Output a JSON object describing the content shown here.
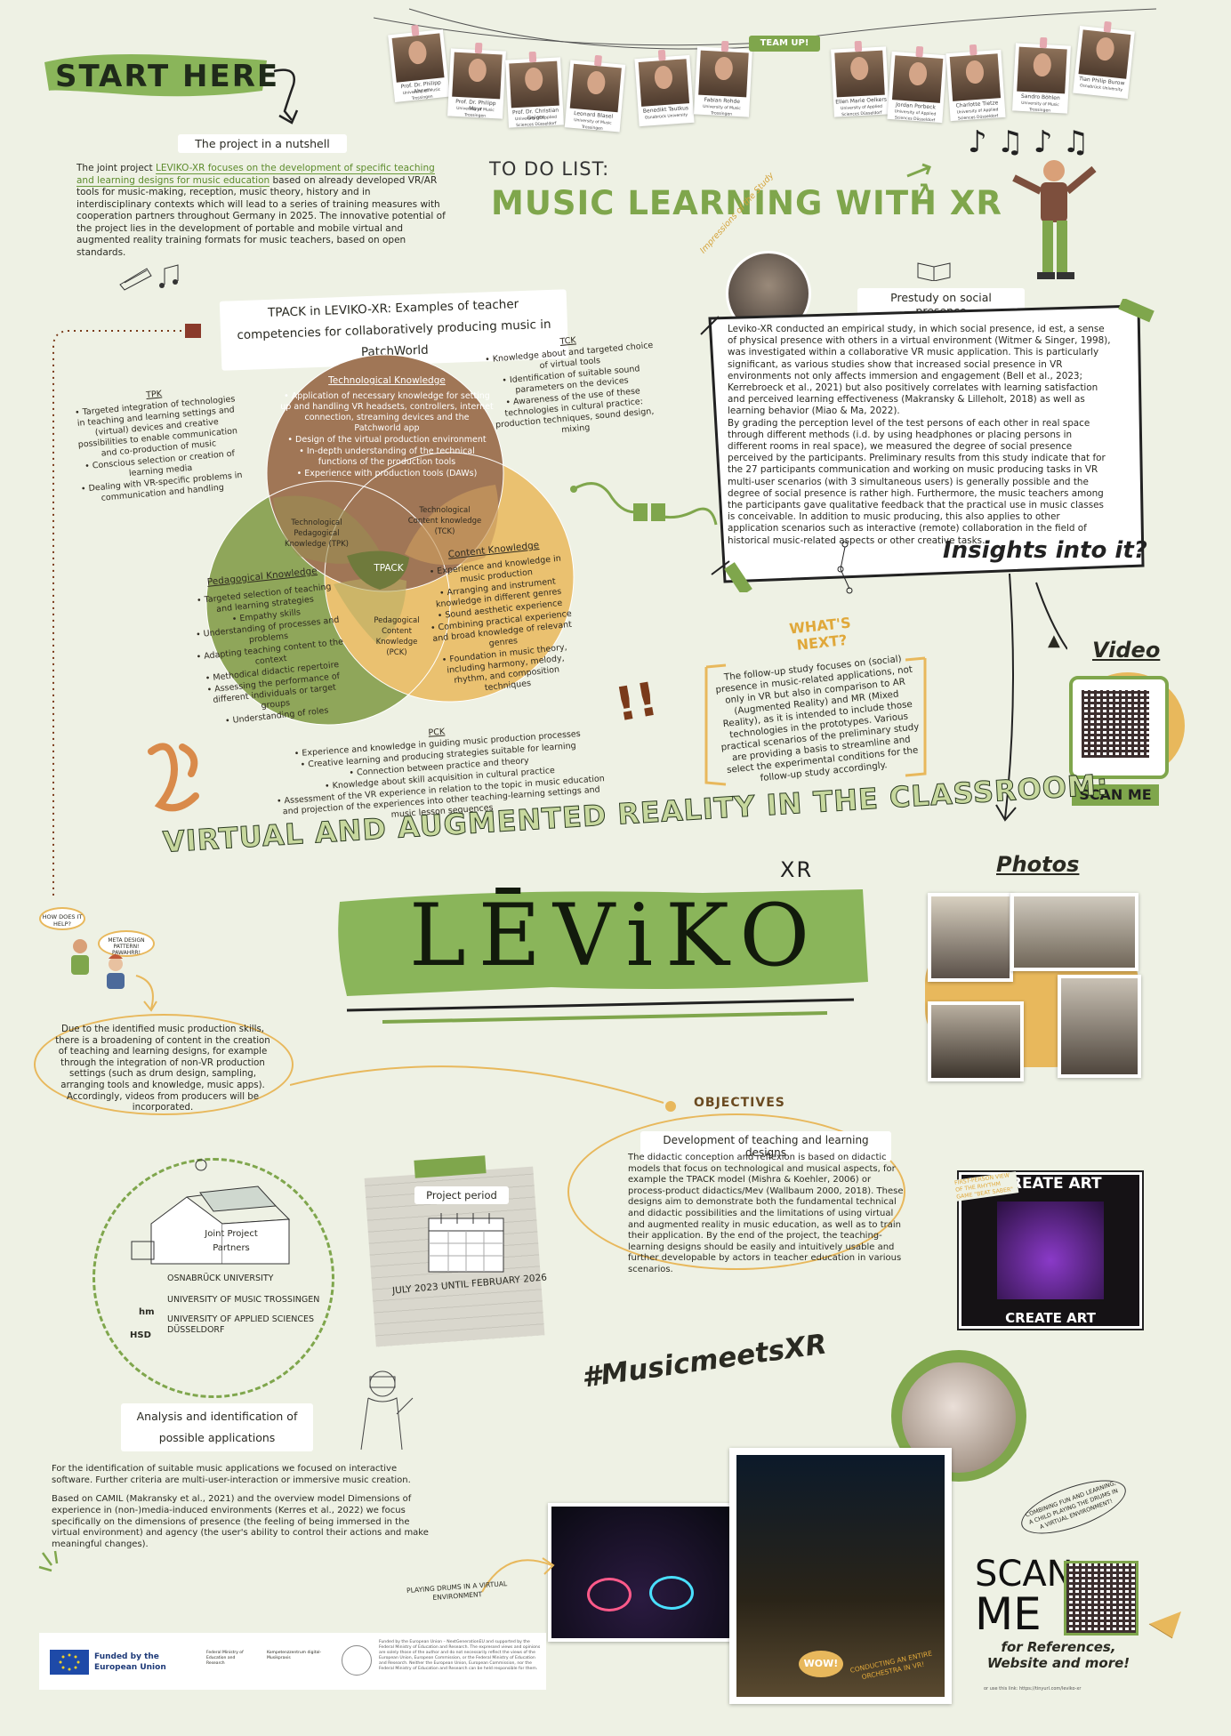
{
  "start_here": "START HERE",
  "team": {
    "badge": "TEAM UP!",
    "members": [
      {
        "name": "Prof. Dr. Philipp Ahner",
        "role": "University of Music Trossingen"
      },
      {
        "name": "Prof. Dr. Philipp Mayr",
        "role": "University of Music Trossingen"
      },
      {
        "name": "Prof. Dr. Christian Geiger",
        "role": "University of Applied Sciences Düsseldorf"
      },
      {
        "name": "Leonard Blasel",
        "role": "University of Music Trossingen"
      },
      {
        "name": "Benedikt Tautkus",
        "role": "Osnabrück University"
      },
      {
        "name": "Fabian Rohde",
        "role": "University of Music Trossingen"
      },
      {
        "name": "Ellen Marie Oelkers",
        "role": "University of Applied Sciences Düsseldorf"
      },
      {
        "name": "Jordan Porbeck",
        "role": "University of Applied Sciences Düsseldorf"
      },
      {
        "name": "Charlotte Tietze",
        "role": "University of Applied Sciences Düsseldorf"
      },
      {
        "name": "Sandro Böhlen",
        "role": "University of Music Trossingen"
      },
      {
        "name": "Tian Philip Burow",
        "role": "Osnabrück University"
      }
    ]
  },
  "nutshell": {
    "heading": "The project in a nutshell",
    "text_before": "The joint project ",
    "text_link": "LEVIKO-XR focuses on the development of specific teaching and learning designs for music education",
    "text_after": " based on already developed VR/AR tools for music-making, reception, music theory, history and in interdisciplinary contexts which will lead to a series of training measures with cooperation partners throughout Germany in 2025. The innovative potential of the project lies in the development of portable and mobile virtual and augmented reality training formats for music teachers, based on open standards."
  },
  "todo": {
    "line1": "TO DO LIST:",
    "line2": "MUSIC LEARNING WITH XR"
  },
  "tpack": {
    "heading": "TPACK in LEVIKO-XR: Examples of teacher competencies for collaboratively producing music in PatchWorld",
    "tpk_label": "TPK",
    "tpk_items": [
      "Targeted integration of technologies in teaching and learning settings and (virtual) devices and creative possibilities to enable communication and co-production of music",
      "Conscious selection or creation of learning media",
      "Dealing with VR-specific problems in communication and handling"
    ],
    "tck_label": "TCK",
    "tck_items": [
      "Knowledge about and targeted choice of virtual tools",
      "Identification of suitable sound parameters on the devices",
      "Awareness of the use of these technologies in cultural practice: production techniques, sound design, mixing"
    ],
    "tk_title": "Technological Knowledge",
    "tk_items": [
      "Application of necessary knowledge for setting up and handling VR headsets, controllers, internet connection, streaming devices and the Patchworld app",
      "Design of the virtual production environment",
      "In-depth understanding of the technical functions of the production tools",
      "Experience with production tools (DAWs)"
    ],
    "pk_title": "Pedagogical Knowledge",
    "pk_items": [
      "Targeted selection of teaching and learning strategies",
      "Empathy skills",
      "Understanding of processes and problems",
      "Adapting teaching content to the context",
      "Methodical didactic repertoire",
      "Assessing the performance of different individuals or target groups",
      "Understanding of roles"
    ],
    "ck_title": "Content Knowledge",
    "ck_items": [
      "Experience and knowledge in music production",
      "Arranging and instrument knowledge in different genres",
      "Sound aesthetic experience",
      "Combining practical experience and broad knowledge of relevant genres",
      "Foundation in music theory, including harmony, melody, rhythm, and composition techniques"
    ],
    "tpk_center": "Technological Pedagogical Knowledge (TPK)",
    "tck_center": "Technological Content knowledge (TCK)",
    "pck_center": "Pedagogical Content Knowledge (PCK)",
    "tpack_center": "TPACK",
    "pck_label": "PCK",
    "pck_items": [
      "Experience and knowledge in guiding music production processes",
      "Creative learning and producing strategies suitable for learning",
      "Connection between practice and theory",
      "Knowledge about skill acquisition in cultural practice",
      "Assessment of the VR experience in relation to the topic in music education and projection of the experiences into other teaching-learning settings and music lesson sequences"
    ]
  },
  "prestudy": {
    "impressions": "Impressions of the Study",
    "heading": "Prestudy on social presence",
    "text": "Leviko-XR conducted an empirical study, in which social presence, id est, a sense of physical presence with others in a virtual environment (Witmer & Singer, 1998), was investigated within a collaborative VR music application. This is particularly significant, as various studies show that increased social presence in VR environments not only affects immersion and engagement (Bell et al., 2023; Kerrebroeck et al., 2021) but also positively correlates with learning satisfaction and perceived learning effectiveness (Makransky & Lilleholt, 2018) as well as learning behavior (Miao & Ma, 2022).\nBy grading the perception level of the test persons of each other in real space through different methods (i.d. by using headphones or placing persons in different rooms in real space), we measured the degree of social presence perceived by the participants. Preliminary results from this study indicate that for the 27 participants communication and working on music producing tasks in VR multi-user scenarios (with 3 simultaneous users) is generally possible and the degree of social presence is rather high. Furthermore, the music teachers among the participants gave qualitative feedback that the practical use in music classes is conceivable. In addition to music producing, this also applies to other application scenarios such as interactive (remote) collaboration in the field of historical music-related aspects or other creative tasks.",
    "insights": "Insights into it?"
  },
  "whats_next": {
    "title": "WHAT'S NEXT?",
    "text": "The follow-up study focuses on (social) presence in music-related applications, not only in VR but also in comparison to AR (Augmented Reality) and MR (Mixed Reality), as it is intended to include those technologies in the prototypes. Various practical scenarios of the preliminary study are providing a basis to streamline and select the experimental conditions for the follow-up study accordingly."
  },
  "video": {
    "title": "Video",
    "scan": "SCAN ME"
  },
  "main_title": {
    "line": "VIRTUAL AND AUGMENTED REALITY IN THE CLASSROOM:",
    "logo": "LĒViKO",
    "suffix": "XR"
  },
  "photos_title": "Photos",
  "how": {
    "bubble1": "HOW DOES IT HELP?",
    "bubble2": "META DESIGN PATTERN! PAWAHRR!"
  },
  "broadening_text": "Due to the identified music production skills, there is a broadening of content in the creation of teaching and learning designs, for example through the integration of non-VR production settings (such as drum design, sampling, arranging tools and knowledge, music apps). Accordingly, videos from producers will be incorporated.",
  "objectives": {
    "label": "OBJECTIVES",
    "heading": "Development of teaching and learning designs",
    "text": "The didactic conception and reflexion is based on didactic models that focus on technological and musical aspects, for example the TPACK model (Mishra & Koehler, 2006) or process-product didactics/Mev (Wallbaum 2000, 2018). These designs aim to demonstrate both the fundamental technical and didactic possibilities and the limitations of using virtual and augmented reality in music education, as well as to train their application. By the end of the project, the teaching-learning designs should be easily and intuitively usable and further developable by actors in teacher education in various scenarios."
  },
  "partners": {
    "label": "Joint Project Partners",
    "items": [
      "OSNABRÜCK UNIVERSITY",
      "UNIVERSITY OF MUSIC TROSSINGEN",
      "UNIVERSITY OF APPLIED SCIENCES DÜSSELDORF"
    ],
    "logos": [
      "hm",
      "HSD"
    ]
  },
  "period": {
    "label": "Project period",
    "dates": "JULY 2023 UNTIL FEBRUARY 2026"
  },
  "create_art": {
    "word": "CREATE ART",
    "note": "FIRST-PERSON VIEW OF THE RHYTHM GAME \"BEAT SABER\""
  },
  "hashtag": "#MusicmeetsXR",
  "analysis": {
    "heading": "Analysis and identification of possible applications",
    "p1": "For the identification of suitable music applications we focused on interactive software. Further criteria are multi-user-interaction or immersive music creation.",
    "p2": "Based on CAMIL (Makransky et al., 2021) and the overview model Dimensions of experience in (non-)media-induced environments (Kerres et al., 2022) we focus specifically on the dimensions of presence (the feeling of being immersed in the virtual environment) and agency (the user's ability to control their actions and make meaningful changes)."
  },
  "captions": {
    "drums": "PLAYING DRUMS IN A VIRTUAL ENVIRONMENT",
    "orchestra": "CONDUCTING AN ENTIRE ORCHESTRA IN VR!",
    "combining": "COMBINING FUN AND LEARNING, A CHILD PLAYING THE DRUMS IN A VIRTUAL ENVIRONMENT!",
    "wow": "WOW!"
  },
  "scan_refs": {
    "scan": "SCAN",
    "me": "ME",
    "text": "for References, Website and more!",
    "link": "or use this link: https://tinyurl.com/leviko-xr"
  },
  "footer": {
    "eu": "Funded by the European Union",
    "funding": "Funded by the European Union – NextGenerationEU and supported by the Federal Ministry of Education and Research. The expressed views and opinions are solely those of the author and do not necessarily reflect the views of the European Union, European Commission, or the Federal Ministry of Education and Research. Neither the European Union, European Commission, nor the Federal Ministry of Education and Research can be held responsible for them.",
    "bmbf": "Federal Ministry of Education and Research",
    "kompetenz": "Kompetenzzentrum digital-Musikpraxis"
  },
  "colors": {
    "bg": "#eef1e4",
    "green": "#7fa64c",
    "brown": "#a07656",
    "olive": "#8fa65a",
    "orange": "#e8b85c"
  }
}
